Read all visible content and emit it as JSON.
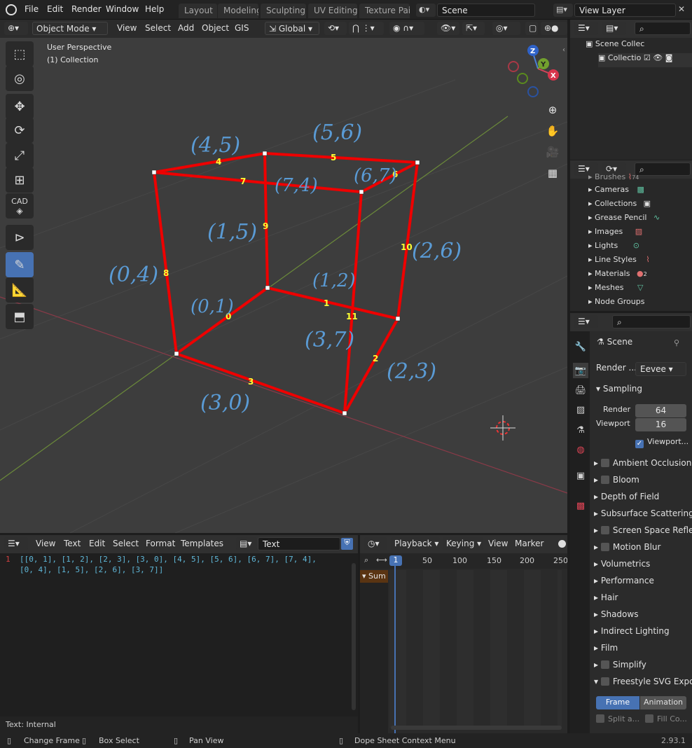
{
  "topbar": {
    "menus": [
      "File",
      "Edit",
      "Render",
      "Window",
      "Help"
    ],
    "workspace_tabs": [
      "Layout",
      "Modeling",
      "Sculpting",
      "UV Editing",
      "Texture Paint"
    ],
    "scene_name": "Scene",
    "view_layer_name": "View Layer"
  },
  "viewport": {
    "mode": "Object Mode",
    "menus": [
      "View",
      "Select",
      "Add",
      "Object",
      "GIS"
    ],
    "orientation": "Global",
    "info_line1": "User Perspective",
    "info_line2": "(1) Collection",
    "gizmo_axes": {
      "x": "X",
      "y": "Y",
      "z": "Z"
    },
    "edge_labels": [
      "0",
      "1",
      "2",
      "3",
      "4",
      "5",
      "6",
      "7",
      "8",
      "9",
      "10",
      "11"
    ],
    "handwritten": [
      "(4,5)",
      "(5,6)",
      "(7,4)",
      "(6,7)",
      "(1,5)",
      "(2,6)",
      "(0,4)",
      "(1,2)",
      "(0,1)",
      "(3,7)",
      "(2,3)",
      "(3,0)"
    ]
  },
  "tools": {
    "cad_label": "CAD"
  },
  "outliner": {
    "scene_collection": "Scene Collec",
    "collection": "Collectio"
  },
  "datablocks": {
    "items": [
      "Brushes",
      "Cameras",
      "Collections",
      "Grease Pencil",
      "Images",
      "Lights",
      "Line Styles",
      "Materials",
      "Meshes",
      "Node Groups"
    ],
    "materials_count": "2",
    "brushes_count": "74"
  },
  "properties": {
    "scene_label": "Scene",
    "render_engine_label": "Render ...",
    "render_engine": "Eevee",
    "sampling_label": "Sampling",
    "render_label": "Render",
    "render_value": "64",
    "viewport_label": "Viewport",
    "viewport_value": "16",
    "viewport_denoise": "Viewport...",
    "panels": [
      "Ambient Occlusion",
      "Bloom",
      "Depth of Field",
      "Subsurface Scattering",
      "Screen Space Refle",
      "Motion Blur",
      "Volumetrics",
      "Performance",
      "Hair",
      "Shadows",
      "Indirect Lighting",
      "Film",
      "Simplify",
      "Freestyle SVG Expo"
    ],
    "frame_tab": "Frame",
    "animation_tab": "Animation",
    "split_label": "Split a...",
    "fill_label": "Fill Co..."
  },
  "text_editor": {
    "menus": [
      "View",
      "Text",
      "Edit",
      "Select",
      "Format",
      "Templates"
    ],
    "datablock_name": "Text",
    "line_number": "1",
    "code_line1": "[[0, 1], [1, 2], [2, 3], [3, 0], [4, 5], [5, 6], [6, 7], [7, 4],",
    "code_line2": "[0, 4], [1, 5], [2, 6], [3, 7]]",
    "status": "Text: Internal"
  },
  "dopesheet": {
    "menus": [
      "Playback",
      "Keying",
      "View",
      "Marker"
    ],
    "current_frame": "1",
    "ticks": [
      "50",
      "100",
      "150",
      "200",
      "250"
    ],
    "summary": "Sum"
  },
  "statusbar": {
    "change_frame": "Change Frame",
    "box_select": "Box Select",
    "pan_view": "Pan View",
    "context_menu": "Dope Sheet Context Menu",
    "version": "2.93.1"
  },
  "colors": {
    "accent": "#4772b3",
    "edge_red": "#ee0000",
    "label_yellow": "#ffff33",
    "handwriting_blue": "#5a9bd5",
    "x_axis": "#c0405a",
    "y_axis": "#7a9a3a"
  }
}
